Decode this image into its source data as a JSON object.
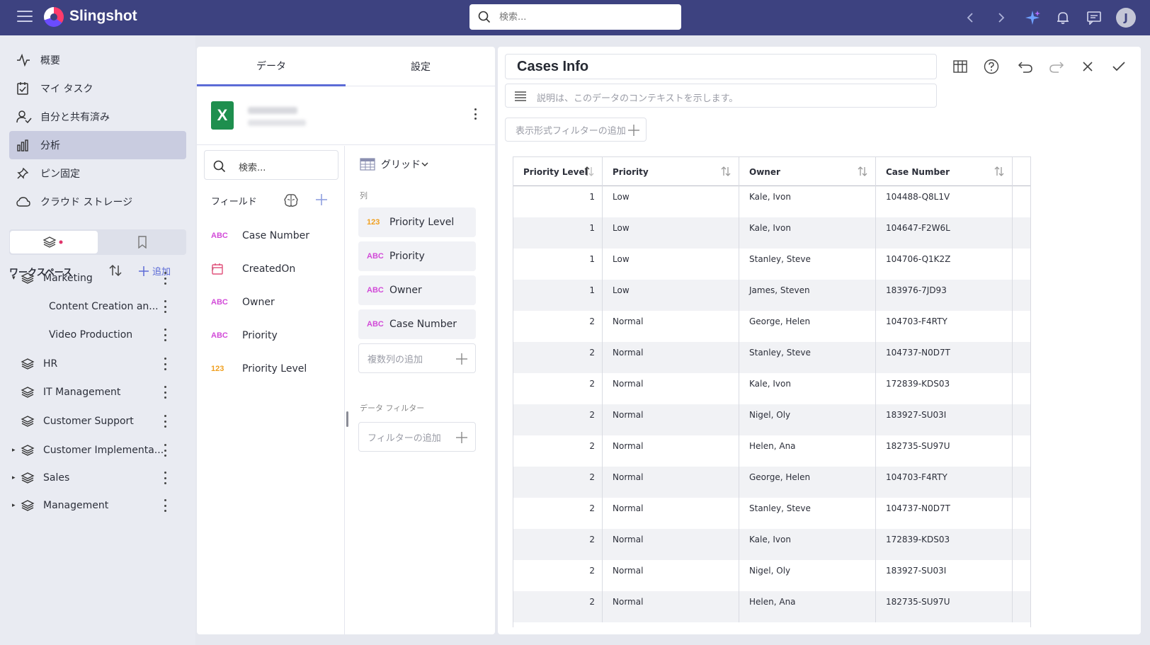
{
  "app": {
    "name": "Slingshot",
    "search_placeholder": "検索..."
  },
  "user": {
    "initial": "J"
  },
  "nav": {
    "items": [
      {
        "label": "概要",
        "icon": "activity-icon"
      },
      {
        "label": "マイ タスク",
        "icon": "task-icon"
      },
      {
        "label": "自分と共有済み",
        "icon": "shared-user-icon"
      },
      {
        "label": "分析",
        "icon": "chart-icon",
        "active": true
      },
      {
        "label": "ピン固定",
        "icon": "pin-icon"
      },
      {
        "label": "クラウド ストレージ",
        "icon": "cloud-icon"
      }
    ]
  },
  "workspaces": {
    "title": "ワークスペース",
    "add_label": "追加",
    "items": [
      {
        "name": "Marketing",
        "expanded": true
      },
      {
        "name": "Content Creation an...",
        "child": true
      },
      {
        "name": "Video Production",
        "child": true
      },
      {
        "name": "HR"
      },
      {
        "name": "IT Management"
      },
      {
        "name": "Customer Support"
      },
      {
        "name": "Customer Implementa...",
        "collapsed": true
      },
      {
        "name": "Sales",
        "collapsed": true
      },
      {
        "name": "Management",
        "collapsed": true
      }
    ]
  },
  "data_panel": {
    "tabs": [
      "データ",
      "設定"
    ],
    "field_search_placeholder": "検索...",
    "fields_label": "フィールド",
    "fields": [
      {
        "type": "ABC",
        "name": "Case Number"
      },
      {
        "type": "date",
        "name": "CreatedOn"
      },
      {
        "type": "ABC",
        "name": "Owner"
      },
      {
        "type": "ABC",
        "name": "Priority"
      },
      {
        "type": "123",
        "name": "Priority Level"
      }
    ],
    "viz_type": "グリッド",
    "columns_label": "列",
    "columns": [
      {
        "type": "123",
        "name": "Priority Level"
      },
      {
        "type": "ABC",
        "name": "Priority"
      },
      {
        "type": "ABC",
        "name": "Owner"
      },
      {
        "type": "ABC",
        "name": "Case Number"
      }
    ],
    "add_columns": "複数列の追加",
    "data_filter_label": "データ フィルター",
    "add_filter": "フィルターの追加"
  },
  "viz": {
    "title": "Cases Info",
    "description_placeholder": "説明は、このデータのコンテキストを示します。",
    "add_vis_filter": "表示形式フィルターの追加",
    "table": {
      "columns": [
        "Priority Level",
        "Priority",
        "Owner",
        "Case Number"
      ],
      "rows": [
        [
          "1",
          "Low",
          "Kale, Ivon",
          "104488-Q8L1V"
        ],
        [
          "1",
          "Low",
          "Kale, Ivon",
          "104647-F2W6L"
        ],
        [
          "1",
          "Low",
          "Stanley, Steve",
          "104706-Q1K2Z"
        ],
        [
          "1",
          "Low",
          "James, Steven",
          "183976-7JD93"
        ],
        [
          "2",
          "Normal",
          "George, Helen",
          "104703-F4RTY"
        ],
        [
          "2",
          "Normal",
          "Stanley, Steve",
          "104737-N0D7T"
        ],
        [
          "2",
          "Normal",
          "Kale, Ivon",
          "172839-KDS03"
        ],
        [
          "2",
          "Normal",
          "Nigel, Oly",
          "183927-SU03I"
        ],
        [
          "2",
          "Normal",
          "Helen, Ana",
          "182735-SU97U"
        ],
        [
          "2",
          "Normal",
          "George, Helen",
          "104703-F4RTY"
        ],
        [
          "2",
          "Normal",
          "Stanley, Steve",
          "104737-N0D7T"
        ],
        [
          "2",
          "Normal",
          "Kale, Ivon",
          "172839-KDS03"
        ],
        [
          "2",
          "Normal",
          "Nigel, Oly",
          "183927-SU03I"
        ],
        [
          "2",
          "Normal",
          "Helen, Ana",
          "182735-SU97U"
        ]
      ]
    }
  },
  "colors": {
    "topbar": "#3d4280",
    "accent": "#5c6bd6",
    "abc_tag": "#d24bd8",
    "num_tag": "#f0a020",
    "excel": "#1e8f4e"
  }
}
